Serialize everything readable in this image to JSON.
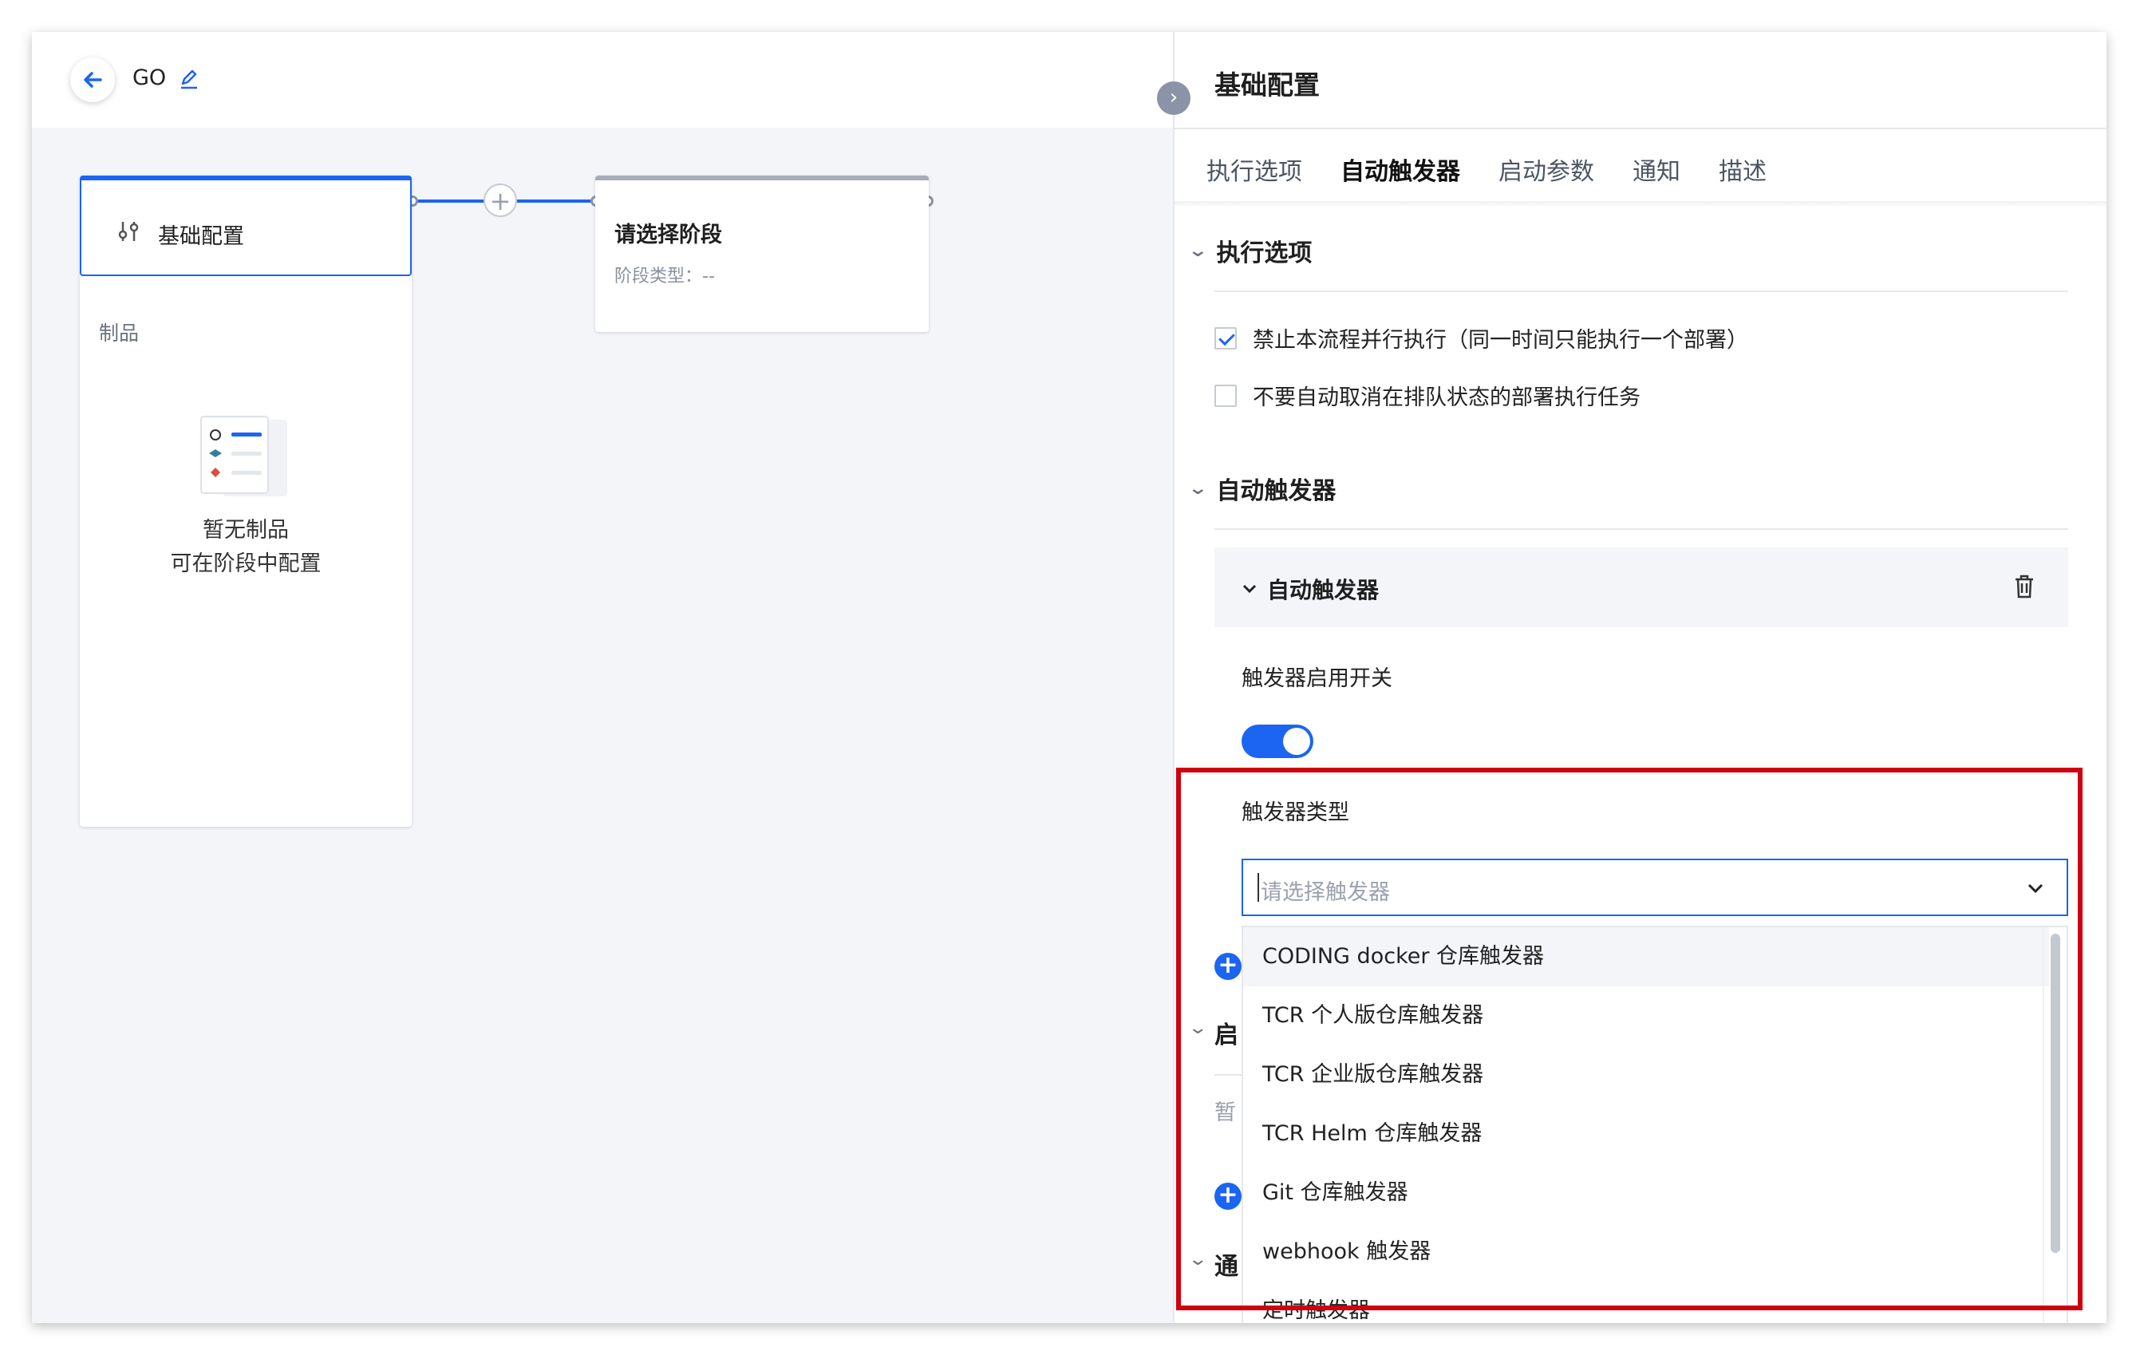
{
  "header": {
    "pipeline_name": "GO"
  },
  "stages": {
    "basic": {
      "title": "基础配置",
      "artifacts_label": "制品",
      "empty_title": "暂无制品",
      "empty_hint": "可在阶段中配置"
    },
    "next": {
      "title": "请选择阶段",
      "type_label": "阶段类型：--"
    }
  },
  "panel": {
    "title": "基础配置",
    "tabs": [
      "执行选项",
      "自动触发器",
      "启动参数",
      "通知",
      "描述"
    ],
    "active_tab": "自动触发器",
    "exec_section": {
      "title": "执行选项",
      "options": [
        {
          "label": "禁止本流程并行执行（同一时间只能执行一个部署）",
          "checked": true
        },
        {
          "label": "不要自动取消在排队状态的部署执行任务",
          "checked": false
        }
      ]
    },
    "trigger_section": {
      "title": "自动触发器",
      "card_title": "自动触发器",
      "switch_label": "触发器启用开关",
      "switch_on": true,
      "type_label": "触发器类型",
      "select_placeholder": "请选择触发器",
      "options": [
        "CODING docker 仓库触发器",
        "TCR 个人版仓库触发器",
        "TCR 企业版仓库触发器",
        "TCR Helm 仓库触发器",
        "Git 仓库触发器",
        "webhook 触发器",
        "定时触发器"
      ]
    },
    "partial_sections": {
      "params_initial": "启",
      "params_empty_initial": "暂",
      "notify_initial": "通"
    }
  },
  "colors": {
    "accent": "#1c64f2",
    "highlight_border": "#d0000f"
  }
}
